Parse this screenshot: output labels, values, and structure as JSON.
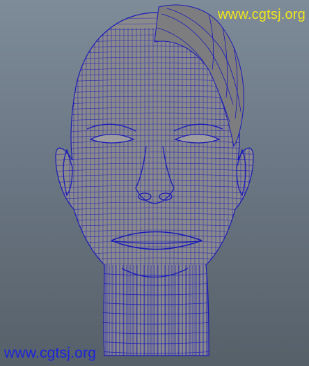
{
  "viewport": {
    "background_top": "#7e8b98",
    "background_bottom": "#566069"
  },
  "model": {
    "surface_color": "#8a8a8d",
    "wireframe_color": "#1a1ab8"
  },
  "watermarks": {
    "top_right": "www.cgtsj.org",
    "bottom_left": "www.cgtsj.org",
    "top_right_color": "#f2e61e",
    "bottom_left_color": "#1d24d9"
  }
}
